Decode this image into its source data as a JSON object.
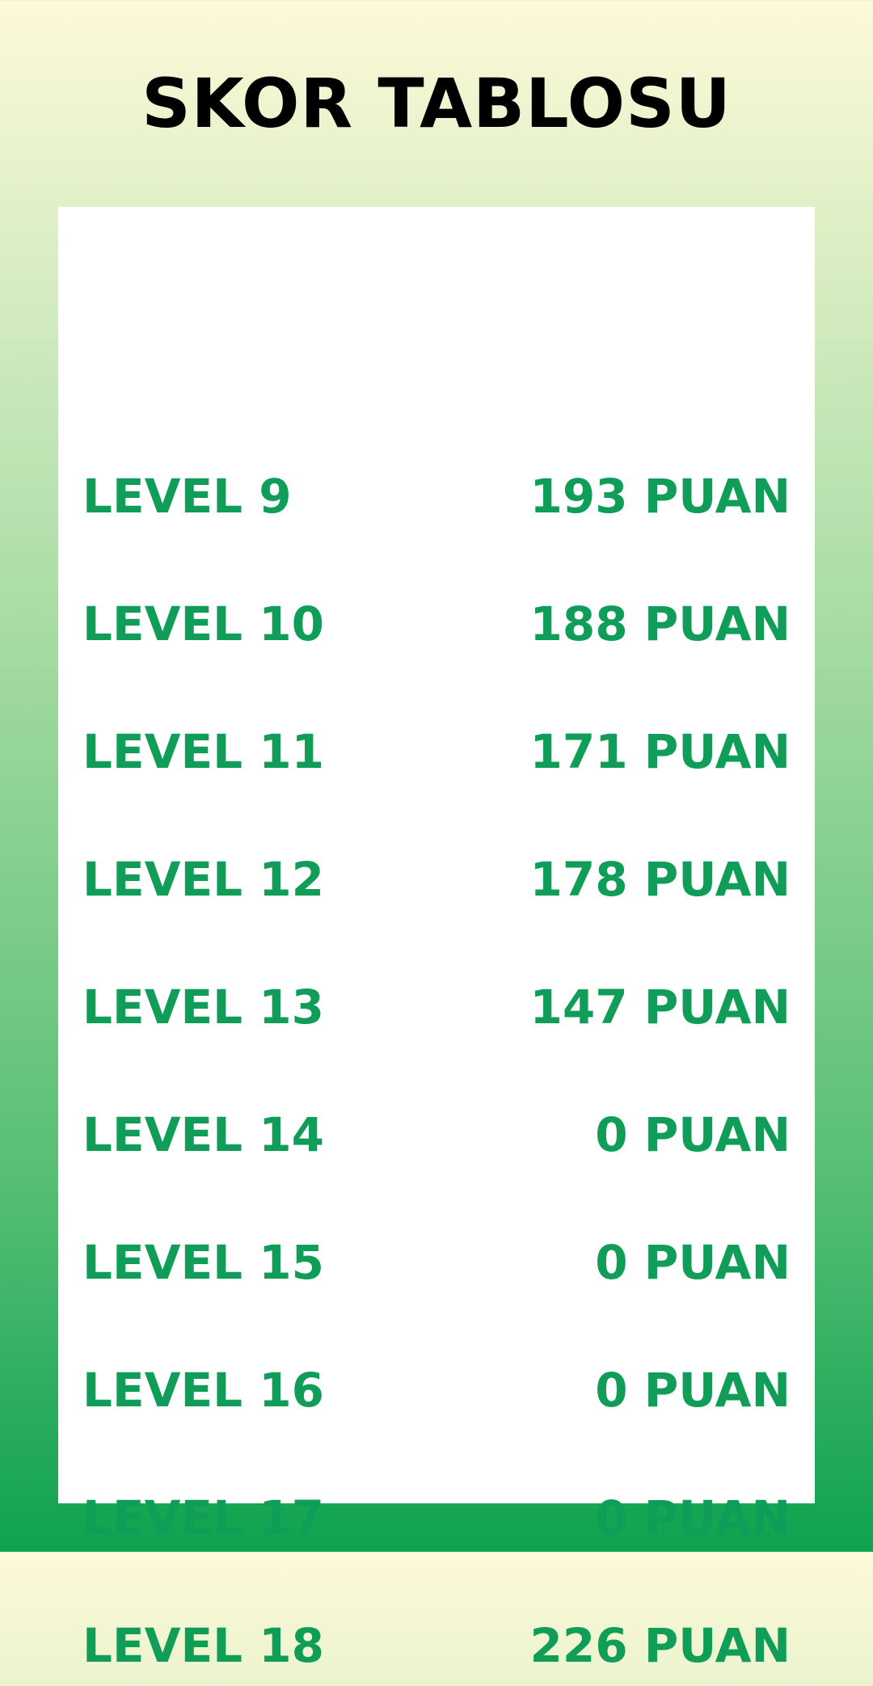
{
  "header": {
    "title": "SKOR TABLOSU"
  },
  "colors": {
    "accent": "#0f9d58",
    "title": "#000000",
    "panel": "#ffffff",
    "gradient_top": "#fdfad8",
    "gradient_bottom": "#0fa24f"
  },
  "scoreboard": {
    "rows": [
      {
        "level": "LEVEL 9",
        "score": "193 PUAN"
      },
      {
        "level": "LEVEL 10",
        "score": "188 PUAN"
      },
      {
        "level": "LEVEL 11",
        "score": "171 PUAN"
      },
      {
        "level": "LEVEL 12",
        "score": "178 PUAN"
      },
      {
        "level": "LEVEL 13",
        "score": "147 PUAN"
      },
      {
        "level": "LEVEL 14",
        "score": "0 PUAN"
      },
      {
        "level": "LEVEL 15",
        "score": "0 PUAN"
      },
      {
        "level": "LEVEL 16",
        "score": "0 PUAN"
      },
      {
        "level": "LEVEL 17",
        "score": "0 PUAN"
      },
      {
        "level": "LEVEL 18",
        "score": "226 PUAN"
      }
    ]
  }
}
